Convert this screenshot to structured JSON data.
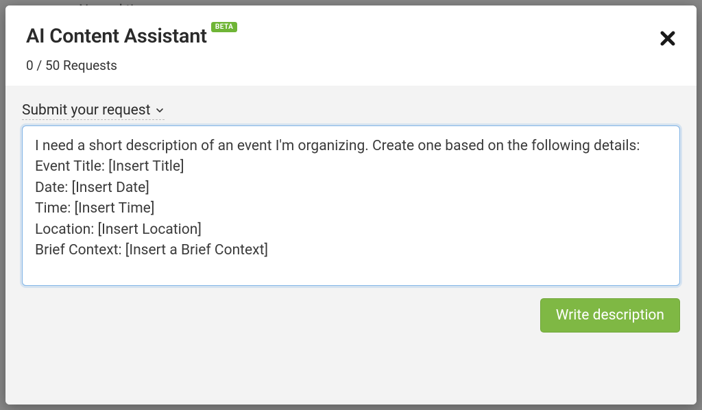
{
  "backdrop": {
    "peek_text": "No end time"
  },
  "modal": {
    "title": "AI Content Assistant",
    "badge": "BETA",
    "requests": "0 / 50 Requests",
    "prompt_label": "Submit your request",
    "textarea_value": "I need a short description of an event I'm organizing. Create one based on the following details:\nEvent Title: [Insert Title]\nDate: [Insert Date]\nTime: [Insert Time]\nLocation: [Insert Location]\nBrief Context: [Insert a Brief Context]",
    "submit_button": "Write description"
  }
}
